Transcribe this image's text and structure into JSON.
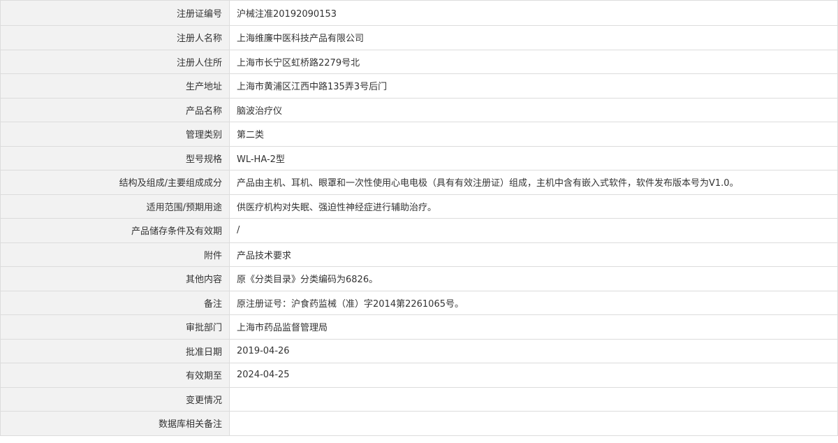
{
  "record": {
    "rows": [
      {
        "label": "注册证编号",
        "value": "沪械注准20192090153"
      },
      {
        "label": "注册人名称",
        "value": "上海维廉中医科技产品有限公司"
      },
      {
        "label": "注册人住所",
        "value": "上海市长宁区虹桥路2279号北"
      },
      {
        "label": "生产地址",
        "value": "上海市黄浦区江西中路135弄3号后门"
      },
      {
        "label": "产品名称",
        "value": "脑波治疗仪"
      },
      {
        "label": "管理类别",
        "value": "第二类"
      },
      {
        "label": "型号规格",
        "value": "WL-HA-2型"
      },
      {
        "label": "结构及组成/主要组成成分",
        "value": "产品由主机、耳机、眼罩和一次性使用心电电极（具有有效注册证）组成，主机中含有嵌入式软件，软件发布版本号为V1.0。"
      },
      {
        "label": "适用范围/预期用途",
        "value": "供医疗机构对失眠、强迫性神经症进行辅助治疗。"
      },
      {
        "label": "产品储存条件及有效期",
        "value": "/"
      },
      {
        "label": "附件",
        "value": "产品技术要求"
      },
      {
        "label": "其他内容",
        "value": "原《分类目录》分类编码为6826。"
      },
      {
        "label": "备注",
        "value": "原注册证号：沪食药监械（准）字2014第2261065号。"
      },
      {
        "label": "审批部门",
        "value": "上海市药品监督管理局"
      },
      {
        "label": "批准日期",
        "value": "2019-04-26"
      },
      {
        "label": "有效期至",
        "value": "2024-04-25"
      },
      {
        "label": "变更情况",
        "value": ""
      },
      {
        "label": "数据库相关备注",
        "value": ""
      }
    ]
  }
}
